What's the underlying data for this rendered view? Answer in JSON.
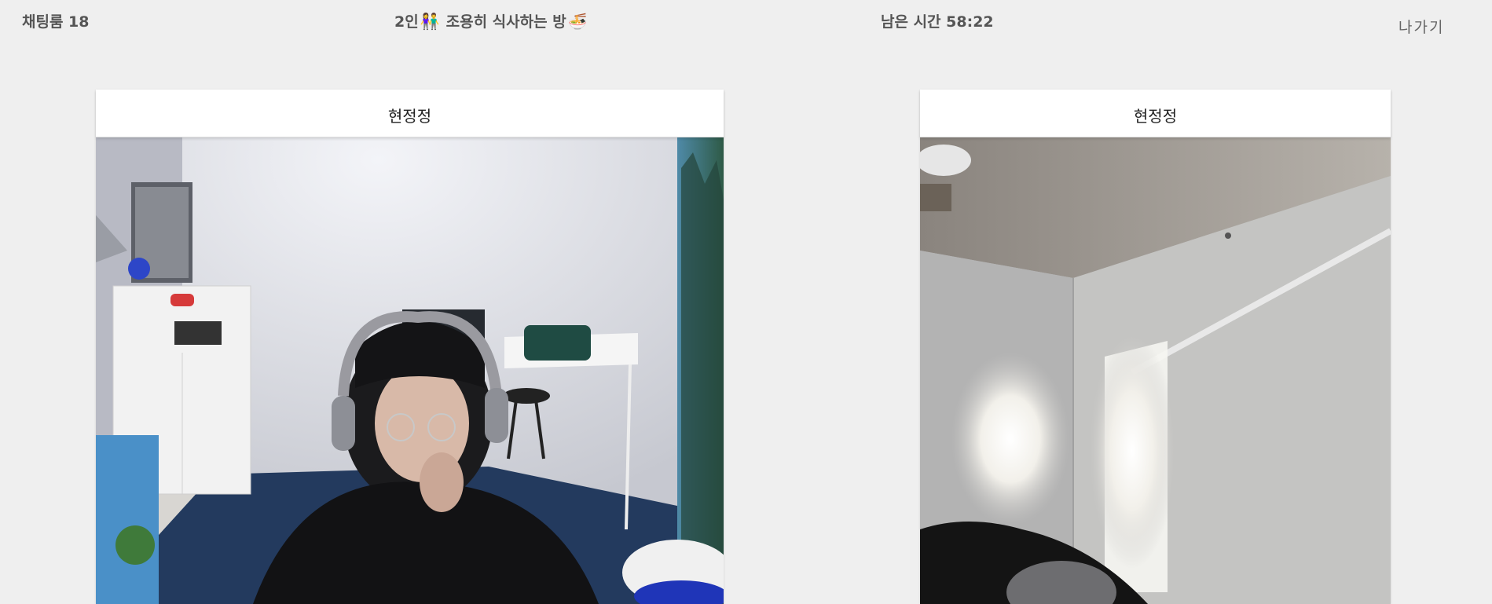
{
  "header": {
    "room_number": "채팅룸 18",
    "room_title_prefix": "2인",
    "room_title_icon_people": "👫",
    "room_title_text": "조용히 식사하는 방",
    "room_title_icon_food": "🍜",
    "timer": "남은 시간 58:22",
    "exit_label": "나가기"
  },
  "participants": [
    {
      "name": "현정정",
      "menu_icon": "more-horizontal-icon"
    },
    {
      "name": "현정정",
      "menu_icon": "more-horizontal-icon"
    }
  ],
  "colors": {
    "background": "#efefef",
    "card": "#ffffff",
    "header_text": "#555555"
  }
}
